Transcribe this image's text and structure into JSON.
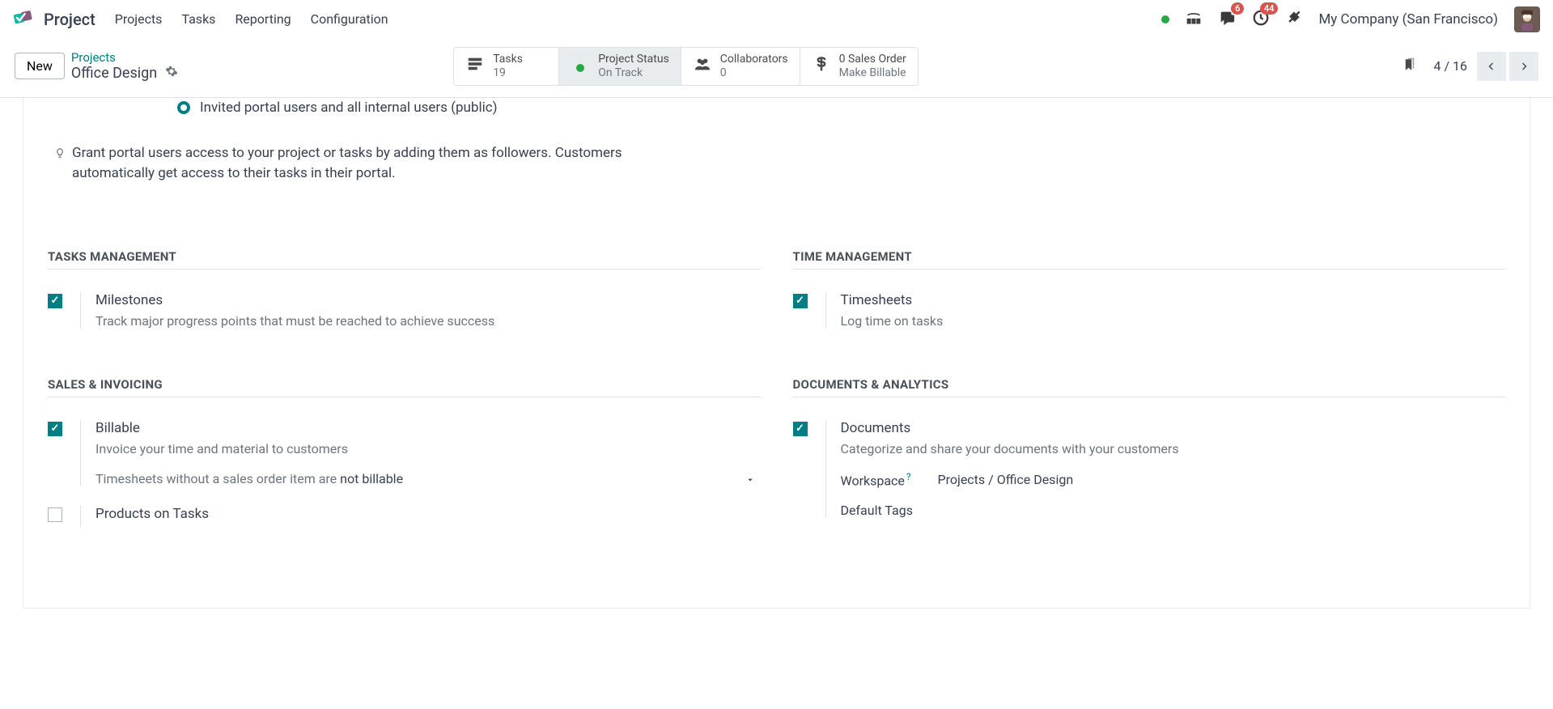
{
  "topnav": {
    "app": "Project",
    "menu": [
      "Projects",
      "Tasks",
      "Reporting",
      "Configuration"
    ],
    "company": "My Company (San Francisco)",
    "messages_badge": "6",
    "activities_badge": "44"
  },
  "controlbar": {
    "new_label": "New",
    "breadcrumb_parent": "Projects",
    "breadcrumb_current": "Office Design",
    "stats": {
      "tasks_label": "Tasks",
      "tasks_value": "19",
      "status_label": "Project Status",
      "status_value": "On Track",
      "collab_label": "Collaborators",
      "collab_value": "0",
      "sales_label": "0 Sales Order",
      "sales_value": "Make Billable"
    },
    "pager": "4 / 16"
  },
  "visibility": {
    "public_label": "Invited portal users and all internal users (public)",
    "tip": "Grant portal users access to your project or tasks by adding them as followers. Customers automatically get access to their tasks in their portal."
  },
  "sections": {
    "tasks": {
      "title": "TASKS MANAGEMENT",
      "milestones_label": "Milestones",
      "milestones_desc": "Track major progress points that must be reached to achieve success"
    },
    "time": {
      "title": "TIME MANAGEMENT",
      "timesheets_label": "Timesheets",
      "timesheets_desc": "Log time on tasks"
    },
    "sales": {
      "title": "SALES & INVOICING",
      "billable_label": "Billable",
      "billable_desc": "Invoice your time and material to customers",
      "ts_prefix": "Timesheets without a sales order item are",
      "ts_value": "not billable",
      "products_label": "Products on Tasks"
    },
    "docs": {
      "title": "DOCUMENTS & ANALYTICS",
      "documents_label": "Documents",
      "documents_desc": "Categorize and share your documents with your customers",
      "workspace_label": "Workspace",
      "workspace_value": "Projects / Office Design",
      "tags_label": "Default Tags"
    }
  }
}
